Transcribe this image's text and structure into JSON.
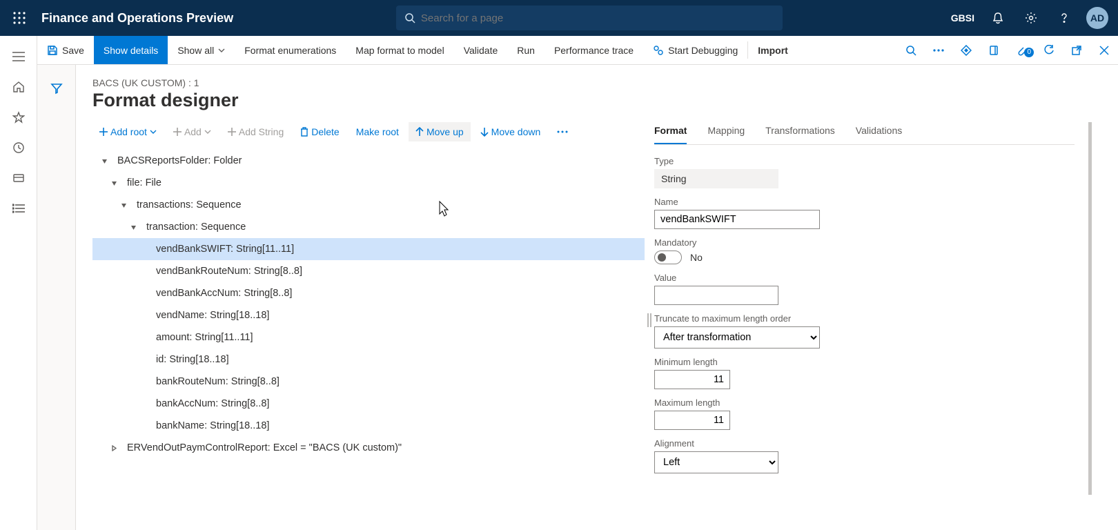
{
  "header": {
    "app_title": "Finance and Operations Preview",
    "search_placeholder": "Search for a page",
    "company": "GBSI",
    "avatar_initials": "AD"
  },
  "cmdbar": {
    "save": "Save",
    "show_details": "Show details",
    "show_all": "Show all",
    "format_enum": "Format enumerations",
    "map_format": "Map format to model",
    "validate": "Validate",
    "run": "Run",
    "perf_trace": "Performance trace",
    "start_debug": "Start Debugging",
    "import": "Import",
    "attach_count": "0"
  },
  "page": {
    "breadcrumb": "BACS (UK CUSTOM) : 1",
    "title": "Format designer"
  },
  "toolbar": {
    "add_root": "Add root",
    "add": "Add",
    "add_string": "Add String",
    "delete": "Delete",
    "make_root": "Make root",
    "move_up": "Move up",
    "move_down": "Move down"
  },
  "tree": [
    {
      "indent": 0,
      "twist": "down",
      "label": "BACSReportsFolder: Folder",
      "sel": false
    },
    {
      "indent": 1,
      "twist": "down",
      "label": "file: File",
      "sel": false
    },
    {
      "indent": 2,
      "twist": "down",
      "label": "transactions: Sequence",
      "sel": false
    },
    {
      "indent": 3,
      "twist": "down",
      "label": "transaction: Sequence",
      "sel": false
    },
    {
      "indent": 4,
      "twist": "",
      "label": "vendBankSWIFT: String[11..11]",
      "sel": true
    },
    {
      "indent": 4,
      "twist": "",
      "label": "vendBankRouteNum: String[8..8]",
      "sel": false
    },
    {
      "indent": 4,
      "twist": "",
      "label": "vendBankAccNum: String[8..8]",
      "sel": false
    },
    {
      "indent": 4,
      "twist": "",
      "label": "vendName: String[18..18]",
      "sel": false
    },
    {
      "indent": 4,
      "twist": "",
      "label": "amount: String[11..11]",
      "sel": false
    },
    {
      "indent": 4,
      "twist": "",
      "label": "id: String[18..18]",
      "sel": false
    },
    {
      "indent": 4,
      "twist": "",
      "label": "bankRouteNum: String[8..8]",
      "sel": false
    },
    {
      "indent": 4,
      "twist": "",
      "label": "bankAccNum: String[8..8]",
      "sel": false
    },
    {
      "indent": 4,
      "twist": "",
      "label": "bankName: String[18..18]",
      "sel": false
    },
    {
      "indent": 1,
      "twist": "right",
      "label": "ERVendOutPaymControlReport: Excel = \"BACS (UK custom)\"",
      "sel": false
    }
  ],
  "prop_tabs": {
    "format": "Format",
    "mapping": "Mapping",
    "transformations": "Transformations",
    "validations": "Validations"
  },
  "props": {
    "type_label": "Type",
    "type_value": "String",
    "name_label": "Name",
    "name_value": "vendBankSWIFT",
    "mandatory_label": "Mandatory",
    "mandatory_value": "No",
    "value_label": "Value",
    "value_value": "",
    "truncate_label": "Truncate to maximum length order",
    "truncate_value": "After transformation",
    "minlen_label": "Minimum length",
    "minlen_value": "11",
    "maxlen_label": "Maximum length",
    "maxlen_value": "11",
    "alignment_label": "Alignment",
    "alignment_value": "Left"
  }
}
